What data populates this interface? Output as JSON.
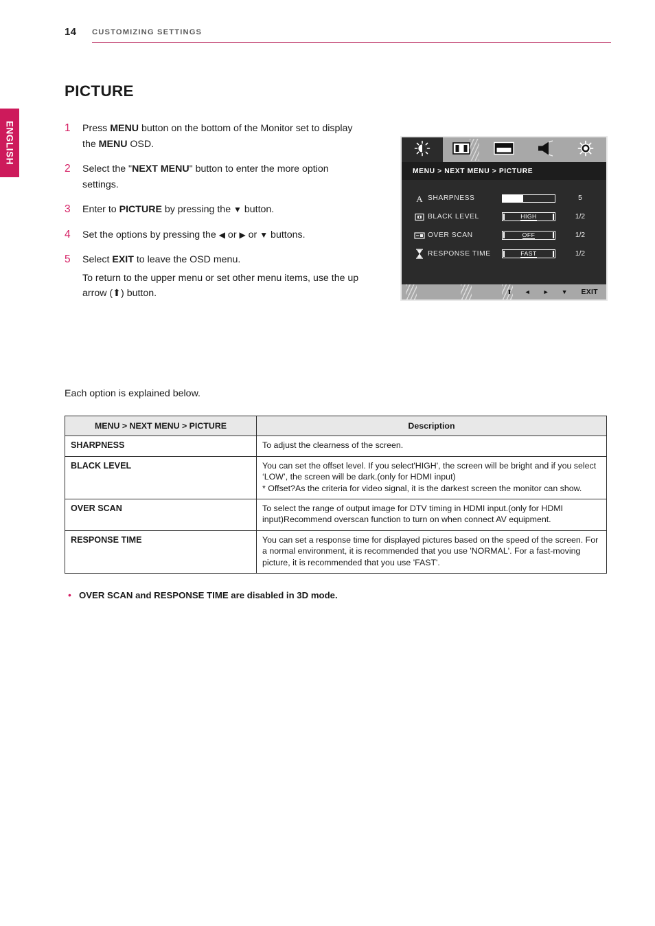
{
  "sidebar": {
    "language_tab": "ENGLISH",
    "accent_color": "#cd1a5b"
  },
  "header": {
    "page_number": "14",
    "chapter": "CUSTOMIZING SETTINGS",
    "rule_color": "#b3144f"
  },
  "section": {
    "title": "PICTURE"
  },
  "steps": [
    {
      "number": "1",
      "parts": [
        "Press ",
        "MENU",
        " button on the bottom of the Monitor set to display the ",
        "MENU",
        " OSD."
      ]
    },
    {
      "number": "2",
      "parts": [
        "Select the \"",
        "NEXT MENU",
        "\" button to enter the more option settings."
      ]
    },
    {
      "number": "3",
      "parts": [
        "Enter to ",
        "PICTURE",
        " by pressing the ",
        "▼",
        " button."
      ]
    },
    {
      "number": "4",
      "parts": [
        "Set the options by pressing the ",
        "◀",
        " or ",
        "▶",
        " or ",
        "▼",
        " buttons."
      ]
    },
    {
      "number": "5",
      "parts": [
        "Select ",
        "EXIT",
        " to leave the OSD menu."
      ],
      "sub": "To return to the upper menu or set other menu items, use the up arrow (⬆) button."
    }
  ],
  "osd": {
    "tabs": [
      {
        "icon": "brightness-contrast-icon",
        "selected": true
      },
      {
        "icon": "color-bars-icon",
        "selected": false
      },
      {
        "icon": "screen-position-icon",
        "selected": false
      },
      {
        "icon": "speaker-volume-icon",
        "selected": false
      },
      {
        "icon": "settings-gear-icon",
        "selected": false
      }
    ],
    "breadcrumb": "MENU  >  NEXT MENU  >  PICTURE",
    "rows": [
      {
        "icon": "letter-a-icon",
        "label": "SHARPNESS",
        "control_type": "slider",
        "fill_percent": 40,
        "value": "5"
      },
      {
        "icon": "black-level-icon",
        "label": "BLACK LEVEL",
        "control_type": "option",
        "option": "HIGH",
        "value": "1/2"
      },
      {
        "icon": "over-scan-icon",
        "label": "OVER SCAN",
        "control_type": "option",
        "option": "OFF",
        "value": "1/2"
      },
      {
        "icon": "hourglass-icon",
        "label": "RESPONSE TIME",
        "control_type": "option",
        "option": "FAST",
        "value": "1/2"
      }
    ],
    "nav": {
      "up": "⬆",
      "left": "◄",
      "right": "►",
      "down": "▼",
      "exit_label": "EXIT"
    }
  },
  "table_intro": "Each option is explained below.",
  "table": {
    "headers": [
      "MENU > NEXT MENU > PICTURE",
      "Description"
    ],
    "rows": [
      {
        "name": "SHARPNESS",
        "description": "To adjust the clearness of the screen."
      },
      {
        "name": "BLACK LEVEL",
        "description": "You can set the offset level. If you select'HIGH', the screen will be bright and if you select ‘LOW’, the screen will be dark.(only for HDMI input)\n* Offset?As the criteria for video signal, it is the darkest screen the monitor can show."
      },
      {
        "name": "OVER SCAN",
        "description": "To select the range of output image for DTV timing in HDMI input.(only for HDMI input)Recommend overscan function to turn on when connect AV equipment."
      },
      {
        "name": "RESPONSE TIME",
        "description": "You can set a response time for displayed pictures based on the speed of the screen. For a normal environment, it is recommended that you use 'NORMAL'. For a fast-moving picture, it is recommended that you use 'FAST'."
      }
    ]
  },
  "note": {
    "bullet": "•",
    "text": "OVER SCAN and RESPONSE TIME are disabled in 3D mode."
  }
}
